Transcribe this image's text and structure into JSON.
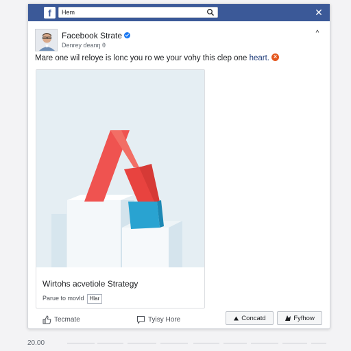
{
  "topbar": {
    "logo": "f",
    "search": {
      "value": "Hem",
      "placeholder": ""
    },
    "close": "✕"
  },
  "post": {
    "page_name": "Facebook Strate",
    "subline": "Denrey ɗeanŋ θ",
    "text_main": "Mare one wil reloye is lonc you ro we your vohy this clep one ",
    "text_link": "heart.",
    "badge": "✕",
    "collapse": "^"
  },
  "card": {
    "title": "Wirtohs acvetiole Strategy",
    "subtitle": "Parue to movld",
    "tag": "Hlar"
  },
  "actions": {
    "left": "Tecmate",
    "middle": "Tyisy Hore",
    "contact_label": "Concatd",
    "follow_label": "Fyfhow"
  },
  "footer": {
    "counter": "20.00"
  },
  "colors": {
    "topbar": "#3b5998",
    "accent_red": "#ef5350",
    "accent_blue": "#29a3d1",
    "badge": "#e4571e"
  }
}
